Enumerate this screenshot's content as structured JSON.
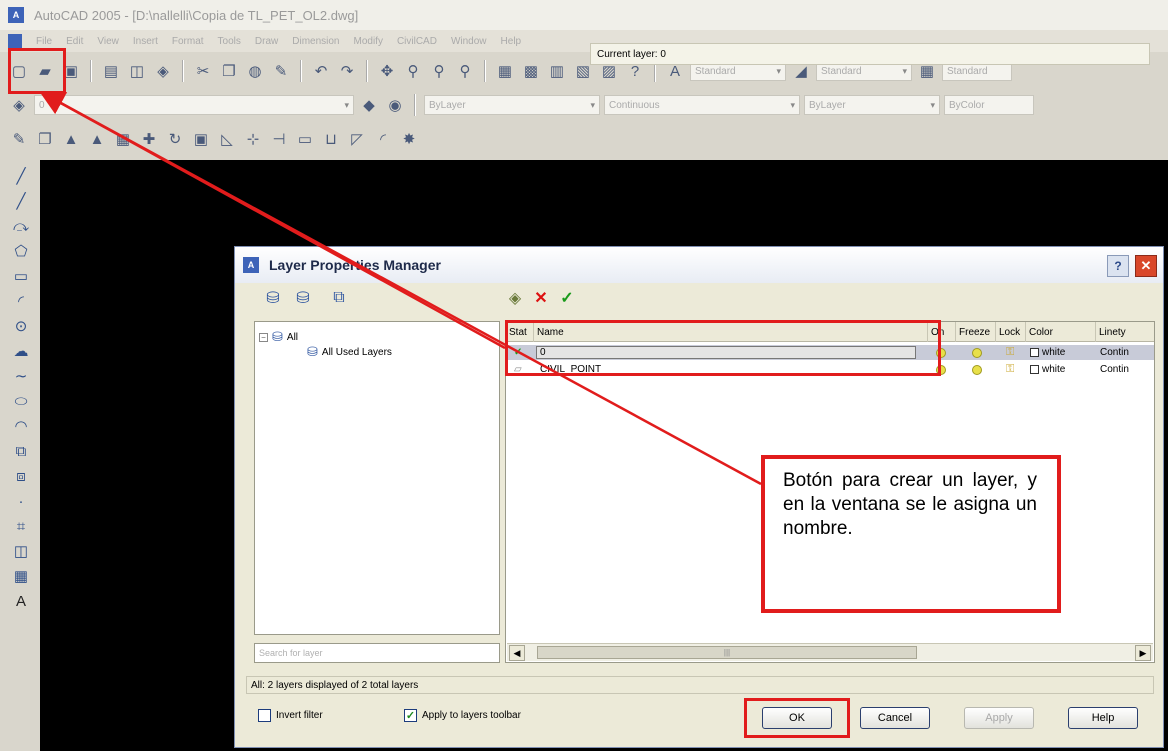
{
  "window": {
    "title": "AutoCAD 2005 - [D:\\nallelli\\Copia de TL_PET_OL2.dwg]",
    "menu": [
      "File",
      "Edit",
      "View",
      "Insert",
      "Format",
      "Tools",
      "Draw",
      "Dimension",
      "Modify",
      "CivilCAD",
      "Window",
      "Help"
    ]
  },
  "toolbar": {
    "text_style": "Standard",
    "dim_style": "Standard",
    "table_style": "Standard",
    "layer_combo": "0",
    "color_combo": "ByLayer",
    "linetype_combo": "Continuous",
    "lineweight_combo": "ByLayer",
    "plotstyle_combo": "ByColor"
  },
  "dialog": {
    "title": "Layer Properties Manager",
    "help": "?",
    "close": "✕",
    "current_layer": "Current layer: 0",
    "tree": {
      "root": "All",
      "child": "All Used Layers"
    },
    "search_placeholder": "Search for layer",
    "columns": [
      "Stat",
      "Name",
      "On",
      "Freeze",
      "Lock",
      "Color",
      "Linetype"
    ],
    "column_labels": {
      "stat": "Stat",
      "name": "Name",
      "on": "On",
      "freeze": "Freeze",
      "lock": "Lock",
      "color": "Color",
      "linetype": "Linety"
    },
    "layers": [
      {
        "name": "0",
        "color": "white",
        "linetype": "Contin"
      },
      {
        "name": "CIVIL_POINT",
        "color": "white",
        "linetype": "Contin"
      }
    ],
    "status": "All: 2 layers displayed of 2 total layers",
    "invert_filter": "Invert filter",
    "apply_toolbar": "Apply to layers toolbar",
    "buttons": {
      "ok": "OK",
      "cancel": "Cancel",
      "apply": "Apply",
      "help": "Help"
    }
  },
  "annotation": {
    "callout": "Botón para crear un layer, y en la ventana se le asigna un nombre.",
    "highlight_color": "#e11c1c"
  }
}
